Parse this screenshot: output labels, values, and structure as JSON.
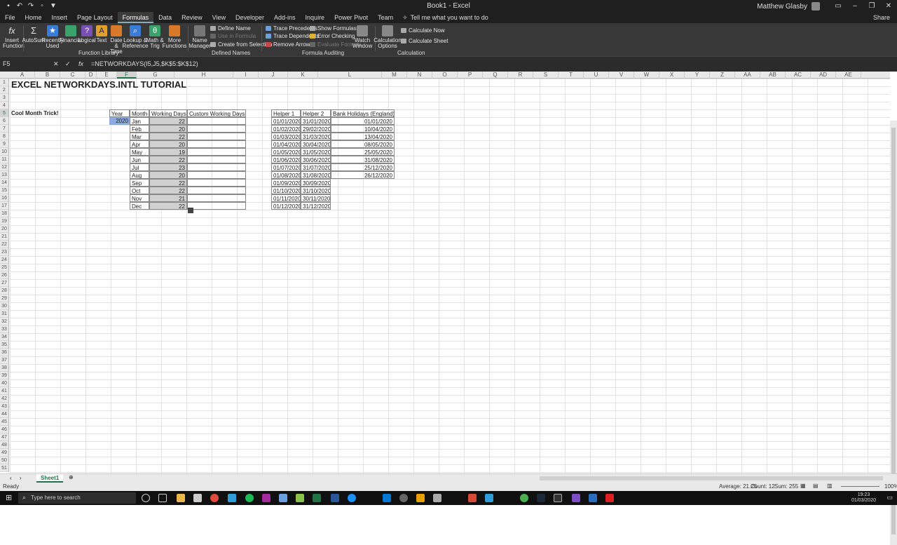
{
  "window": {
    "title": "Book1 - Excel",
    "user": "Matthew Glasby"
  },
  "tabs": [
    "File",
    "Home",
    "Insert",
    "Page Layout",
    "Formulas",
    "Data",
    "Review",
    "View",
    "Developer",
    "Add-ins",
    "Inquire",
    "Power Pivot",
    "Team"
  ],
  "tell_me": "Tell me what you want to do",
  "share": "Share",
  "ribbon": {
    "insert_function": "Insert Function",
    "autosum": "AutoSum",
    "recently_used": "Recently Used",
    "financial": "Financial",
    "logical": "Logical",
    "text": "Text",
    "date_time": "Date & Time",
    "lookup_ref": "Lookup & Reference",
    "math_trig": "Math & Trig",
    "more_functions": "More Functions",
    "function_library": "Function Library",
    "name_manager": "Name Manager",
    "define_name": "Define Name",
    "use_in_formula": "Use in Formula",
    "create_from_selection": "Create from Selection",
    "defined_names": "Defined Names",
    "trace_precedents": "Trace Precedents",
    "trace_dependents": "Trace Dependents",
    "remove_arrows": "Remove Arrows",
    "show_formulas": "Show Formulas",
    "error_checking": "Error Checking",
    "evaluate_formula": "Evaluate Formula",
    "watch_window": "Watch Window",
    "formula_auditing": "Formula Auditing",
    "calculation_options": "Calculation Options",
    "calculate_now": "Calculate Now",
    "calculate_sheet": "Calculate Sheet",
    "calculation": "Calculation"
  },
  "formula_bar": {
    "name_box": "F5",
    "formula": "=NETWORKDAYS(I5,J5,$K$5:$K$12)"
  },
  "columns": [
    "A",
    "B",
    "C",
    "D",
    "E",
    "F",
    "G",
    "H",
    "I",
    "J",
    "K",
    "L",
    "M",
    "N",
    "O",
    "P",
    "Q",
    "R",
    "S",
    "T",
    "U",
    "V",
    "W",
    "X",
    "Y",
    "Z",
    "AA",
    "AB",
    "AC",
    "AD",
    "AE"
  ],
  "rows": [
    "1",
    "2",
    "3",
    "4",
    "5",
    "6",
    "7",
    "8",
    "9",
    "10",
    "11",
    "12",
    "13",
    "14",
    "15",
    "16",
    "17",
    "18",
    "19",
    "20",
    "21",
    "22",
    "23",
    "24",
    "25",
    "26",
    "27",
    "28",
    "29",
    "30",
    "31",
    "32",
    "33",
    "34",
    "35",
    "36",
    "37",
    "38",
    "39",
    "40",
    "41",
    "42",
    "43",
    "44",
    "45",
    "46",
    "47",
    "48",
    "49",
    "50",
    "51"
  ],
  "sheet": {
    "title": "EXCEL NETWORKDAYS.INTL TUTORIAL",
    "note": "Cool Month Trick!",
    "headers": {
      "year": "Year",
      "month": "Month",
      "working_days": "Working Days",
      "custom": "Custom Working Days",
      "helper1": "Helper 1",
      "helper2": "Helper 2",
      "holidays": "Bank Holidays (England)"
    },
    "year": "2020",
    "months": [
      "Jan",
      "Feb",
      "Mar",
      "Apr",
      "May",
      "Jun",
      "Jul",
      "Aug",
      "Sep",
      "Oct",
      "Nov",
      "Dec"
    ],
    "working_days": [
      "22",
      "20",
      "22",
      "20",
      "19",
      "22",
      "23",
      "20",
      "22",
      "22",
      "21",
      "22"
    ],
    "helper1": [
      "01/01/2020",
      "01/02/2020",
      "01/03/2020",
      "01/04/2020",
      "01/05/2020",
      "01/06/2020",
      "01/07/2020",
      "01/08/2020",
      "01/09/2020",
      "01/10/2020",
      "01/11/2020",
      "01/12/2020"
    ],
    "helper2": [
      "31/01/2020",
      "29/02/2020",
      "31/03/2020",
      "30/04/2020",
      "31/05/2020",
      "30/06/2020",
      "31/07/2020",
      "31/08/2020",
      "30/09/2020",
      "31/10/2020",
      "30/11/2020",
      "31/12/2020"
    ],
    "holidays": [
      "01/01/2020",
      "10/04/2020",
      "13/04/2020",
      "08/05/2020",
      "25/05/2020",
      "31/08/2020",
      "25/12/2020",
      "26/12/2020"
    ]
  },
  "sheet_tab": "Sheet1",
  "status": {
    "ready": "Ready",
    "average": "Average: 21.25",
    "count": "Count: 12",
    "sum": "Sum: 255",
    "zoom": "100%"
  },
  "taskbar": {
    "search": "Type here to search",
    "time": "19:23",
    "date": "01/03/2020"
  }
}
